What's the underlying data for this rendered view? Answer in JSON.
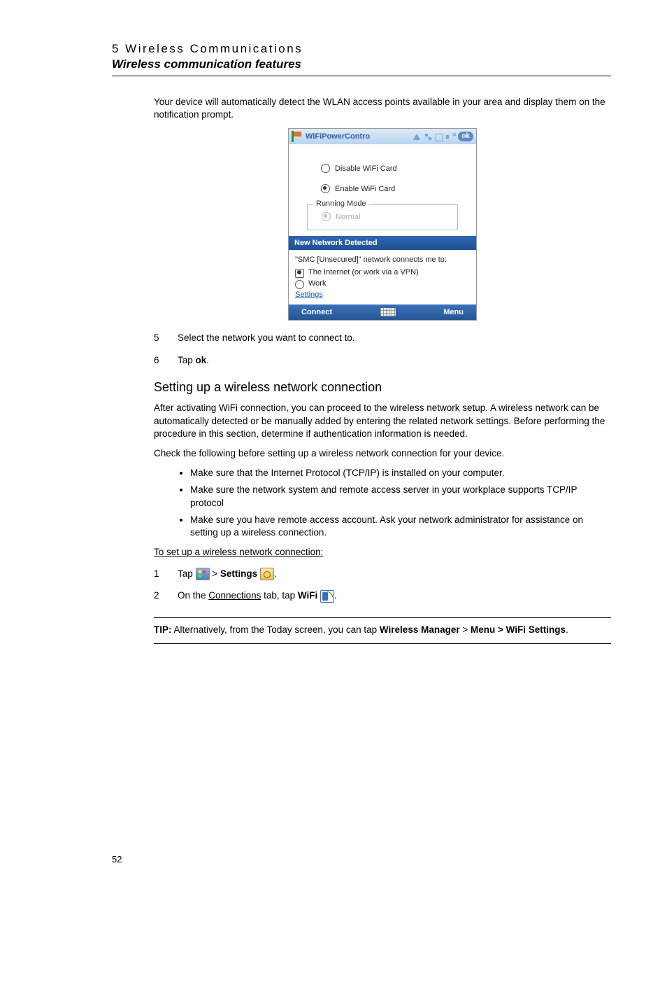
{
  "header": {
    "chapter": "5 Wireless Communications",
    "section": "Wireless communication features"
  },
  "intro_para": "Your device will automatically detect the WLAN access points available in your area and display them on the notification prompt.",
  "screenshot": {
    "title": "WiFiPowerContro",
    "ok": "ok",
    "opt_disable": "Disable WiFi Card",
    "opt_enable": "Enable WiFi Card",
    "fieldset_legend": "Running Mode",
    "fieldset_option": "Normal",
    "popup_title": "New Network Detected",
    "popup_line1": "\"SMC [Unsecured]\" network connects me to:",
    "popup_opt1": "The Internet (or work via a VPN)",
    "popup_opt2": "Work",
    "popup_settings": "Settings",
    "bottom_left": "Connect",
    "bottom_right": "Menu"
  },
  "steps_after": {
    "s5": {
      "num": "5",
      "text": "Select the network you want to connect to."
    },
    "s6": {
      "num": "6",
      "text_pre": "Tap ",
      "text_bold": "ok",
      "text_post": "."
    }
  },
  "subsection_title": "Setting up a wireless network connection",
  "para1": "After activating WiFi connection, you can proceed to the wireless network setup. A wireless network can be automatically detected or be manually added by entering the related network settings. Before performing the procedure in this section, determine if authentication information is needed.",
  "para2": "Check the following before setting up a wireless network connection for your device.",
  "bullets": {
    "b1": "Make sure that the Internet Protocol (TCP/IP) is installed on your computer.",
    "b2": "Make sure the network system and remote access server in your workplace supports TCP/IP protocol",
    "b3": "Make sure you have remote access account. Ask your network administrator for assistance on setting up a wireless connection."
  },
  "proc_title": "To set up a wireless network connection:",
  "proc": {
    "p1": {
      "num": "1",
      "pre": "Tap ",
      "mid": " > ",
      "bold": "Settings",
      "post": " ",
      "end": "."
    },
    "p2": {
      "num": "2",
      "pre": "On the ",
      "link": "Connections",
      "mid": " tab, tap ",
      "bold": "WiFi",
      "post": " ",
      "end": "."
    }
  },
  "tip": {
    "label": "TIP:",
    "pre": "    Alternatively, from the Today screen, you can tap ",
    "b1": "Wireless Manager",
    "gt": " > ",
    "b2": "Menu > WiFi Settings",
    "post": "."
  },
  "pagenum": "52"
}
